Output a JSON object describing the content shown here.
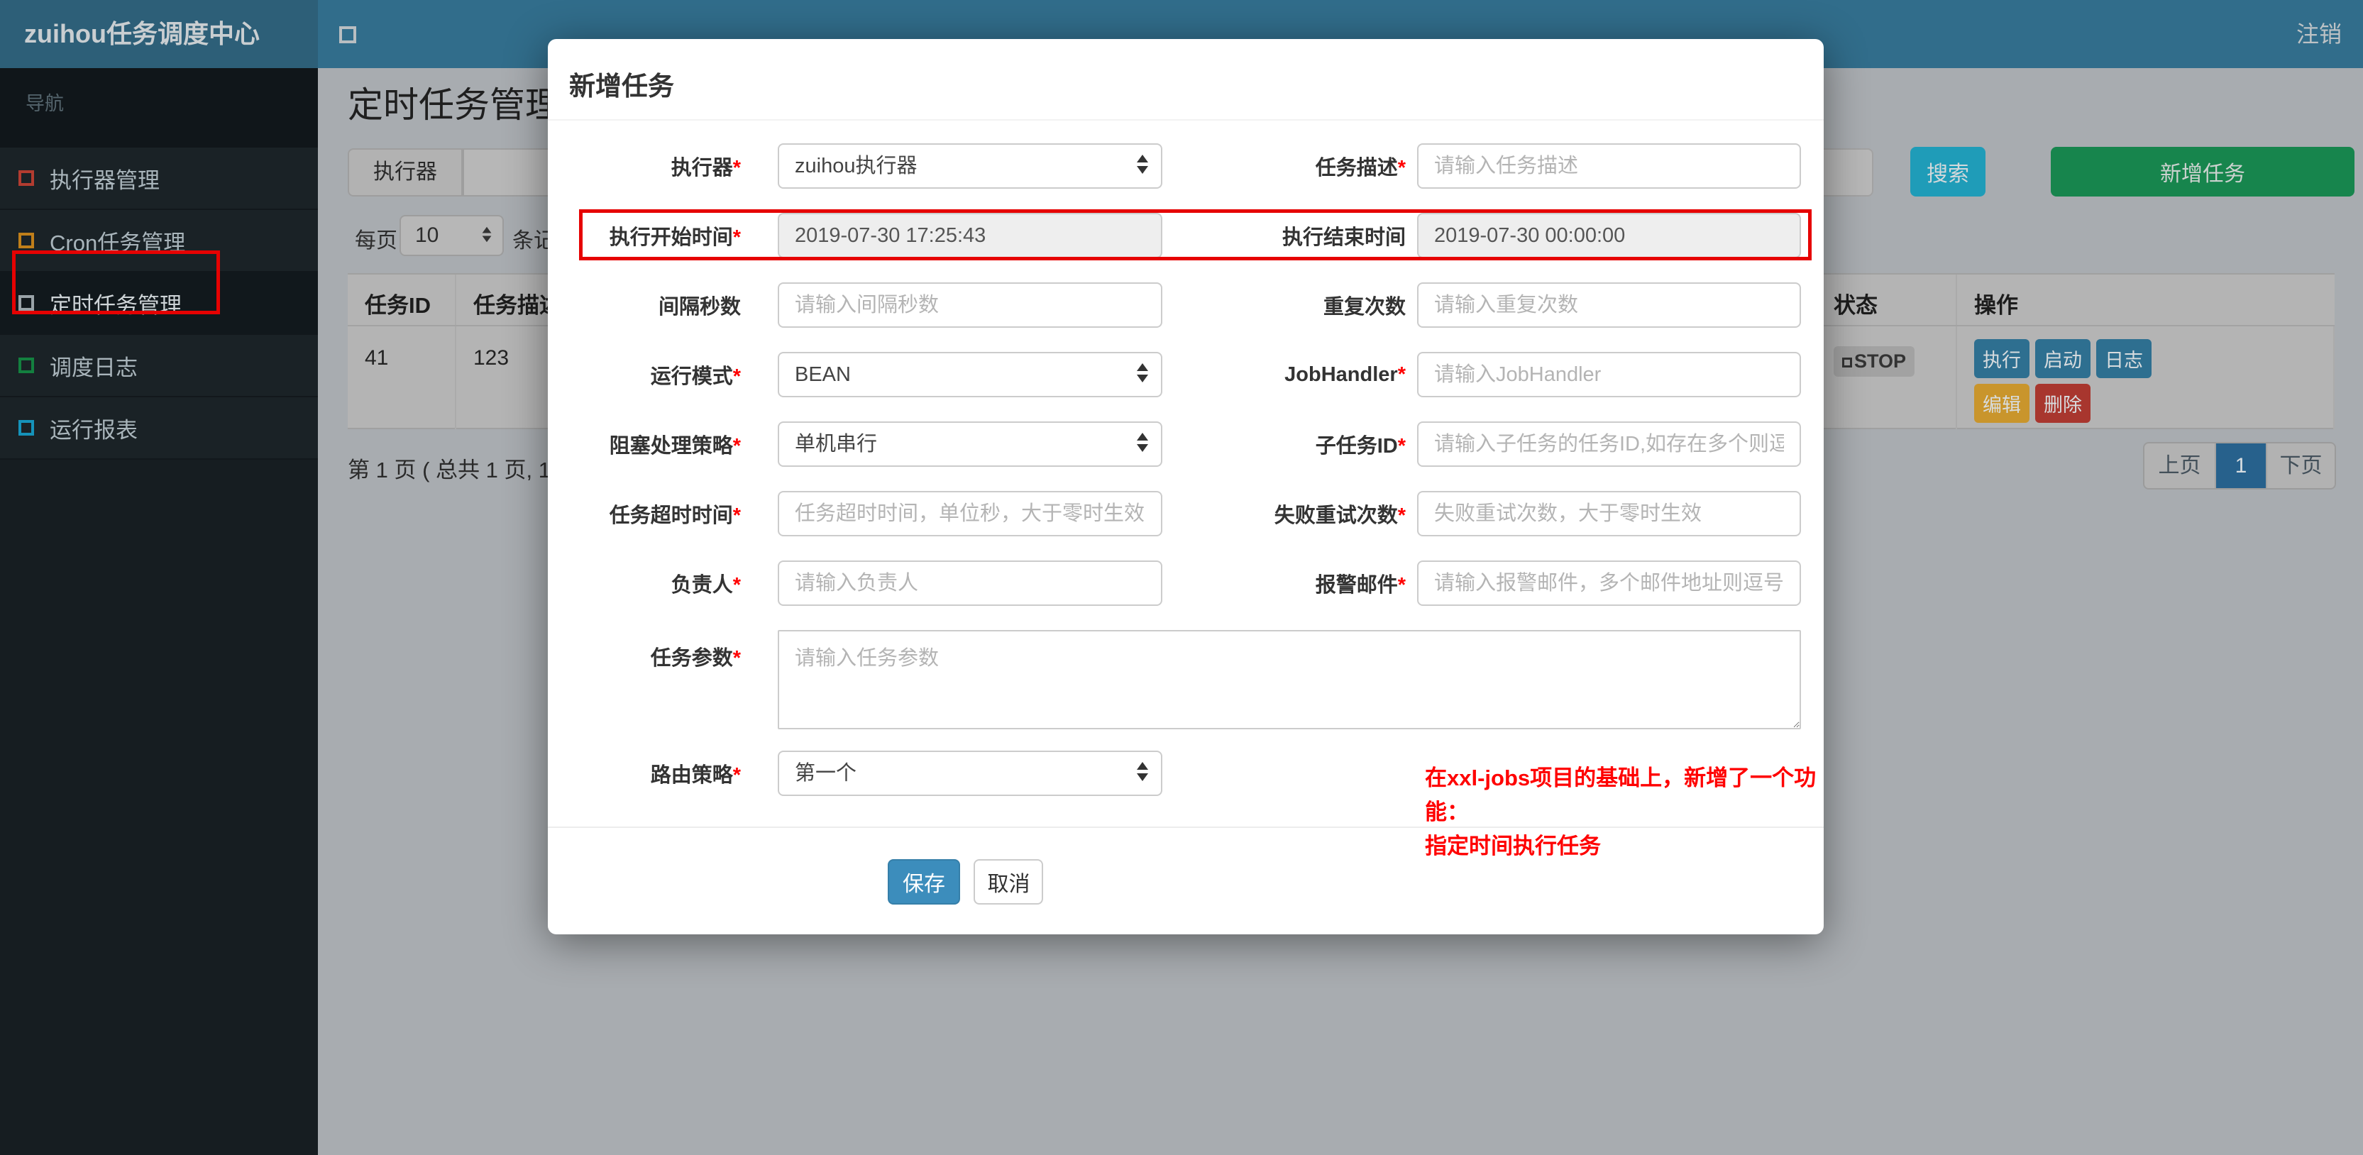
{
  "navbar": {
    "brand": "zuihou任务调度中心",
    "logout": "注销"
  },
  "sidebar": {
    "header": "导航",
    "items": [
      {
        "label": "执行器管理",
        "icon_color": "#b23c30"
      },
      {
        "label": "Cron任务管理",
        "icon_color": "#c07f1a"
      },
      {
        "label": "定时任务管理",
        "icon_color": "#9aa3a8",
        "active": true
      },
      {
        "label": "调度日志",
        "icon_color": "#13803f"
      },
      {
        "label": "运行报表",
        "icon_color": "#1593ba"
      }
    ]
  },
  "page": {
    "title": "定时任务管理",
    "toolbar": {
      "executor_label": "执行器",
      "search": "搜索",
      "add": "新增任务"
    },
    "perpage": {
      "prefix": "每页",
      "value": "10",
      "suffix": "条记"
    },
    "table": {
      "columns": [
        "任务ID",
        "任务描述",
        "状态",
        "操作"
      ],
      "row": {
        "id": "41",
        "desc": "123",
        "status": "STOP",
        "actions": [
          "执行",
          "启动",
          "日志",
          "编辑",
          "删除"
        ]
      }
    },
    "pager": {
      "summary": "第 1 页 ( 总共 1 页, 1",
      "prev": "上页",
      "current": "1",
      "next": "下页"
    }
  },
  "modal": {
    "title": "新增任务",
    "rows": [
      {
        "left": {
          "label": "执行器",
          "star": "*",
          "value": "zuihou执行器"
        },
        "right": {
          "label": "任务描述",
          "star": "*",
          "placeholder": "请输入任务描述"
        }
      },
      {
        "left": {
          "label": "执行开始时间",
          "star": "*",
          "value": "2019-07-30 17:25:43"
        },
        "right": {
          "label": "执行结束时间",
          "star": "",
          "value": "2019-07-30 00:00:00"
        }
      },
      {
        "left": {
          "label": "间隔秒数",
          "star": "",
          "placeholder": "请输入间隔秒数"
        },
        "right": {
          "label": "重复次数",
          "star": "",
          "placeholder": "请输入重复次数"
        }
      },
      {
        "left": {
          "label": "运行模式",
          "star": "*",
          "value": "BEAN"
        },
        "right": {
          "label": "JobHandler",
          "star": "*",
          "placeholder": "请输入JobHandler"
        }
      },
      {
        "left": {
          "label": "阻塞处理策略",
          "star": "*",
          "value": "单机串行"
        },
        "right": {
          "label": "子任务ID",
          "star": "*",
          "placeholder": "请输入子任务的任务ID,如存在多个则逗号分隔"
        }
      },
      {
        "left": {
          "label": "任务超时时间",
          "star": "*",
          "placeholder": "任务超时时间，单位秒，大于零时生效"
        },
        "right": {
          "label": "失败重试次数",
          "star": "*",
          "placeholder": "失败重试次数，大于零时生效"
        }
      },
      {
        "left": {
          "label": "负责人",
          "star": "*",
          "placeholder": "请输入负责人"
        },
        "right": {
          "label": "报警邮件",
          "star": "*",
          "placeholder": "请输入报警邮件，多个邮件地址则逗号分隔"
        }
      }
    ],
    "params": {
      "label": "任务参数",
      "star": "*",
      "placeholder": "请输入任务参数"
    },
    "route": {
      "label": "路由策略",
      "star": "*",
      "value": "第一个"
    },
    "note_line1": "在xxl-jobs项目的基础上，新增了一个功能：",
    "note_line2": "指定时间执行任务",
    "save": "保存",
    "cancel": "取消",
    "accent_color": "#3c8dbc"
  }
}
